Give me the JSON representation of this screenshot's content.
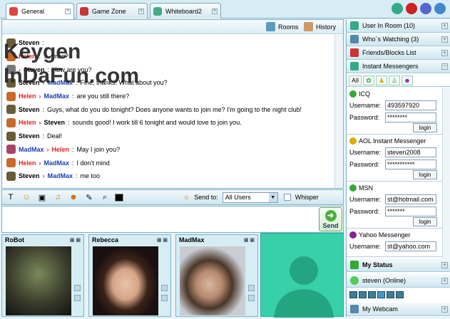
{
  "tabs": [
    {
      "label": "General",
      "color": "#d44"
    },
    {
      "label": "Game Zone",
      "color": "#c33"
    },
    {
      "label": "Whiteboard2",
      "color": "#4a8"
    }
  ],
  "chat": {
    "header": {
      "rooms": "Rooms",
      "history": "History"
    },
    "messages": [
      {
        "from": "Steven",
        "to": "",
        "text": "",
        "color": "#000"
      },
      {
        "from": "Helen",
        "to": "",
        "text": "..., man?",
        "color": "#d22"
      },
      {
        "from": "",
        "to": "Steven",
        "text": "How are you?",
        "color": "#000"
      },
      {
        "from": "Steven",
        "to": "MadMax",
        "text": "Fine, thanks! What about you?",
        "color": "#000"
      },
      {
        "from": "Helen",
        "to": "MadMax",
        "text": "are you still there?",
        "color": "#d22"
      },
      {
        "from": "Steven",
        "to": "",
        "text": "Guys, what do you do tonight? Does anyone wants to join me? I'm going to the night club!",
        "color": "#000"
      },
      {
        "from": "Helen",
        "to": "Steven",
        "text": "sounds good! I work till 6 tonight and would love to join you.",
        "color": "#d22"
      },
      {
        "from": "Steven",
        "to": "",
        "text": "Deal!",
        "color": "#000"
      },
      {
        "from": "MadMax",
        "to": "Helen",
        "text": "May I join you?",
        "color": "#1a3fae"
      },
      {
        "from": "Helen",
        "to": "MadMax",
        "text": "I don't mind",
        "color": "#d22"
      },
      {
        "from": "Steven",
        "to": "MadMax",
        "text": "me too",
        "color": "#000"
      }
    ]
  },
  "toolbar": {
    "send_to_label": "Send to:",
    "send_to_value": "All Users",
    "whisper_label": "Whisper"
  },
  "send_label": "Send",
  "cams": [
    {
      "name": "RoBot"
    },
    {
      "name": "Rebecca"
    },
    {
      "name": "MadMax"
    }
  ],
  "sidebar": {
    "users_in_room": "User In Room (10)",
    "whos_watching": "Who`s Watching (3)",
    "friends": "Friends/Blocks List",
    "instant_messengers": "Instant Messengers",
    "im_tab_all": "All",
    "accounts": [
      {
        "name": "ICQ",
        "username": "493597920",
        "password": "********",
        "login": "login"
      },
      {
        "name": "AOL Instant Messenger",
        "username": "steven2008",
        "password": "***********",
        "login": "login"
      },
      {
        "name": "MSN",
        "username": "st@hotmail.com",
        "password": "*******",
        "login": "login"
      },
      {
        "name": "Yahoo Messenger",
        "username": "st@yahoo.com",
        "password": "",
        "login": ""
      }
    ],
    "username_label": "Username:",
    "password_label": "Password:",
    "my_status": "My Status",
    "online_status": "steven (Online)",
    "my_webcam": "My Webcam"
  },
  "watermark": "Keygen InDaFun.com"
}
